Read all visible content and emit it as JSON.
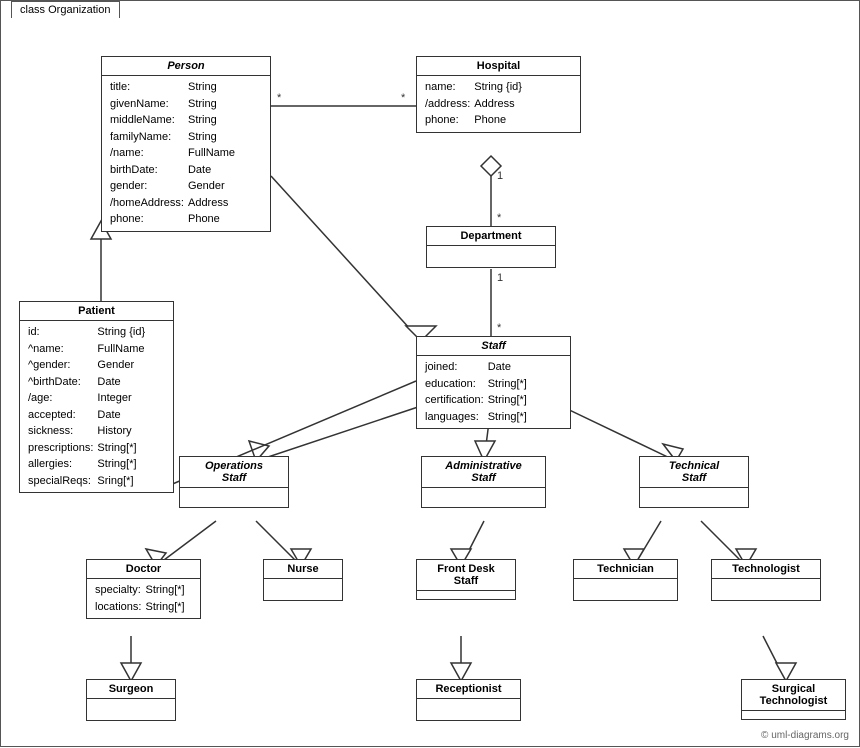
{
  "diagram": {
    "title": "class Organization",
    "copyright": "© uml-diagrams.org",
    "classes": {
      "person": {
        "name": "Person",
        "italic": true,
        "attributes": [
          [
            "title:",
            "String"
          ],
          [
            "givenName:",
            "String"
          ],
          [
            "middleName:",
            "String"
          ],
          [
            "familyName:",
            "String"
          ],
          [
            "/name:",
            "FullName"
          ],
          [
            "birthDate:",
            "Date"
          ],
          [
            "gender:",
            "Gender"
          ],
          [
            "/homeAddress:",
            "Address"
          ],
          [
            "phone:",
            "Phone"
          ]
        ]
      },
      "hospital": {
        "name": "Hospital",
        "italic": false,
        "attributes": [
          [
            "name:",
            "String {id}"
          ],
          [
            "/address:",
            "Address"
          ],
          [
            "phone:",
            "Phone"
          ]
        ]
      },
      "patient": {
        "name": "Patient",
        "italic": false,
        "attributes": [
          [
            "id:",
            "String {id}"
          ],
          [
            "^name:",
            "FullName"
          ],
          [
            "^gender:",
            "Gender"
          ],
          [
            "^birthDate:",
            "Date"
          ],
          [
            "/age:",
            "Integer"
          ],
          [
            "accepted:",
            "Date"
          ],
          [
            "sickness:",
            "History"
          ],
          [
            "prescriptions:",
            "String[*]"
          ],
          [
            "allergies:",
            "String[*]"
          ],
          [
            "specialReqs:",
            "Sring[*]"
          ]
        ]
      },
      "department": {
        "name": "Department",
        "italic": false,
        "attributes": []
      },
      "staff": {
        "name": "Staff",
        "italic": true,
        "attributes": [
          [
            "joined:",
            "Date"
          ],
          [
            "education:",
            "String[*]"
          ],
          [
            "certification:",
            "String[*]"
          ],
          [
            "languages:",
            "String[*]"
          ]
        ]
      },
      "operations_staff": {
        "name": "Operations\nStaff",
        "italic": true,
        "attributes": []
      },
      "administrative_staff": {
        "name": "Administrative\nStaff",
        "italic": true,
        "attributes": []
      },
      "technical_staff": {
        "name": "Technical\nStaff",
        "italic": true,
        "attributes": []
      },
      "doctor": {
        "name": "Doctor",
        "italic": false,
        "attributes": [
          [
            "specialty:",
            "String[*]"
          ],
          [
            "locations:",
            "String[*]"
          ]
        ]
      },
      "nurse": {
        "name": "Nurse",
        "italic": false,
        "attributes": []
      },
      "front_desk_staff": {
        "name": "Front Desk\nStaff",
        "italic": false,
        "attributes": []
      },
      "technician": {
        "name": "Technician",
        "italic": false,
        "attributes": []
      },
      "technologist": {
        "name": "Technologist",
        "italic": false,
        "attributes": []
      },
      "surgeon": {
        "name": "Surgeon",
        "italic": false,
        "attributes": []
      },
      "receptionist": {
        "name": "Receptionist",
        "italic": false,
        "attributes": []
      },
      "surgical_technologist": {
        "name": "Surgical\nTechnologist",
        "italic": false,
        "attributes": []
      }
    }
  }
}
